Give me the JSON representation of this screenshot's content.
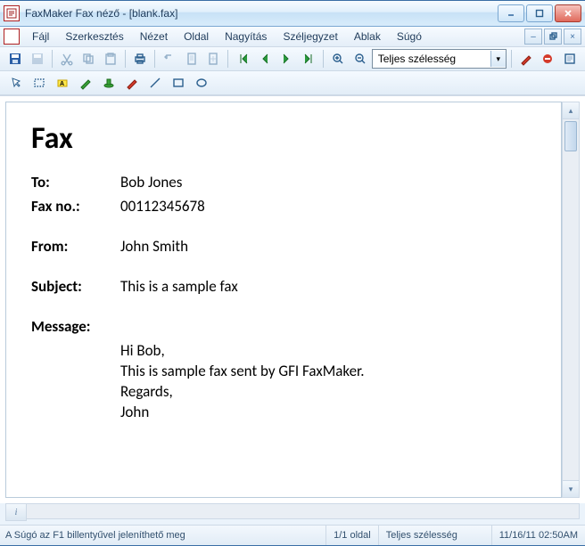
{
  "window": {
    "title": "FaxMaker Fax néző - [blank.fax]"
  },
  "menu": {
    "items": [
      "Fájl",
      "Szerkesztés",
      "Nézet",
      "Oldal",
      "Nagyítás",
      "Széljegyzet",
      "Ablak",
      "Súgó"
    ]
  },
  "toolbar1": {
    "zoom_selected": "Teljes szélesség"
  },
  "fax": {
    "heading": "Fax",
    "to_label": "To:",
    "to_value": "Bob Jones",
    "faxno_label": "Fax no.:",
    "faxno_value": "00112345678",
    "from_label": "From:",
    "from_value": "John Smith",
    "subject_label": "Subject:",
    "subject_value": "This is a sample fax",
    "message_label": "Message:",
    "message_lines": [
      "Hi Bob,",
      "This is sample fax sent by GFI FaxMaker.",
      "Regards,",
      "John"
    ]
  },
  "status": {
    "help": "A Súgó az F1 billentyűvel jeleníthető meg",
    "page": "1/1 oldal",
    "zoom": "Teljes szélesség",
    "datetime": "11/16/11 02:50AM"
  }
}
